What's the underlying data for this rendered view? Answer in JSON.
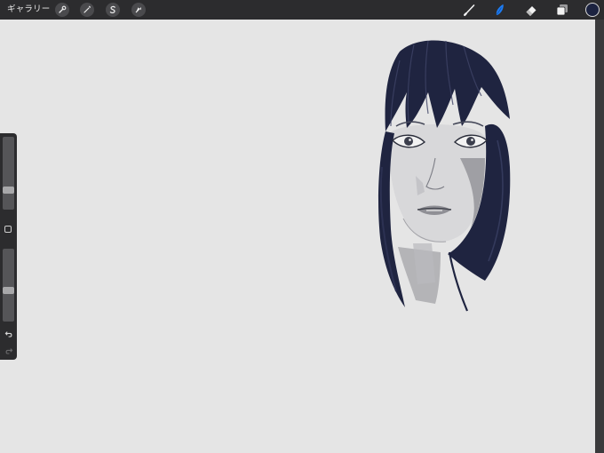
{
  "topbar": {
    "gallery_label": "ギャラリー",
    "left_tools": [
      {
        "name": "actions",
        "icon": "wrench-icon"
      },
      {
        "name": "adjustments",
        "icon": "magic-wand-icon"
      },
      {
        "name": "selection",
        "icon": "selection-s-icon"
      },
      {
        "name": "transform",
        "icon": "arrow-cursor-icon"
      }
    ],
    "right_tools": [
      {
        "name": "brush",
        "icon": "brush-icon",
        "active": false
      },
      {
        "name": "smudge",
        "icon": "smudge-icon",
        "active": true
      },
      {
        "name": "eraser",
        "icon": "eraser-icon",
        "active": false
      },
      {
        "name": "layers",
        "icon": "layers-icon",
        "active": false
      }
    ],
    "current_color": "#1c2340",
    "active_tool_color": "#1e7cf2"
  },
  "sidebar": {
    "brush_size_level": 0.24,
    "opacity_level": 0.42,
    "modify_icon": "square-icon",
    "undo_icon": "undo-icon",
    "redo_icon": "redo-icon"
  },
  "canvas": {
    "background": "#e5e5e5",
    "drawing": "portrait-sketch"
  }
}
